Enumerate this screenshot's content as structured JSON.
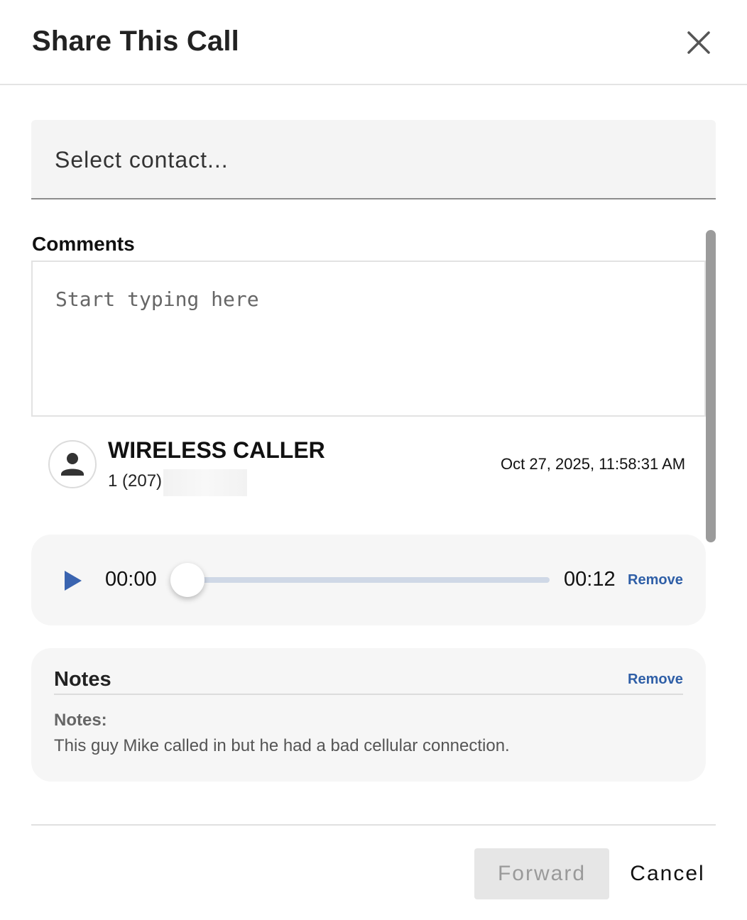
{
  "dialog": {
    "title": "Share This Call"
  },
  "contact_select": {
    "placeholder": "Select contact..."
  },
  "comments": {
    "label": "Comments",
    "placeholder": "Start typing here",
    "value": ""
  },
  "call": {
    "caller_name": "WIRELESS CALLER",
    "phone_prefix": "1 (207)",
    "timestamp": "Oct 27, 2025, 11:58:31 AM"
  },
  "player": {
    "current_time": "00:00",
    "total_time": "00:12",
    "progress": 0,
    "remove_label": "Remove"
  },
  "notes": {
    "title": "Notes",
    "remove_label": "Remove",
    "subtitle": "Notes:",
    "body": "This guy Mike called in but he had a bad cellular connection."
  },
  "footer": {
    "forward_label": "Forward",
    "cancel_label": "Cancel"
  },
  "colors": {
    "accent": "#2f5fa7",
    "play_icon": "#3a64b0",
    "track": "#cfd8e6",
    "card_bg": "#f6f6f6"
  },
  "icons": {
    "close": "close-icon",
    "avatar": "person-icon",
    "play": "play-icon"
  }
}
